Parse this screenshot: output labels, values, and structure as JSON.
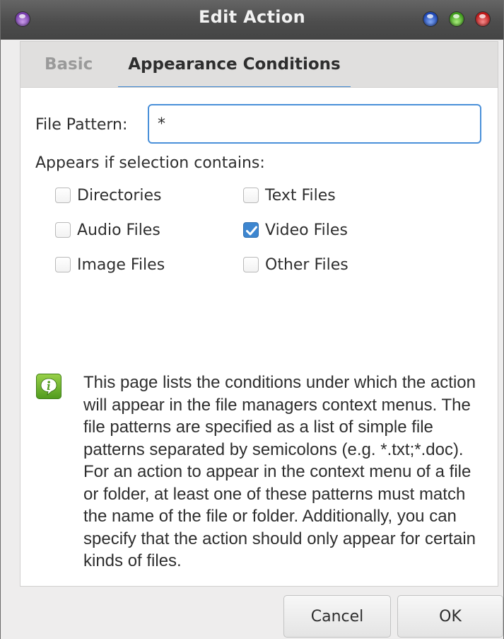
{
  "window": {
    "title": "Edit Action"
  },
  "tabs": [
    {
      "label": "Basic",
      "active": false
    },
    {
      "label": "Appearance Conditions",
      "active": true
    }
  ],
  "file_pattern": {
    "label": "File Pattern:",
    "value": "*"
  },
  "appears": {
    "label": "Appears if selection contains:",
    "options": [
      {
        "label": "Directories",
        "checked": false
      },
      {
        "label": "Text Files",
        "checked": false
      },
      {
        "label": "Audio Files",
        "checked": false
      },
      {
        "label": "Video Files",
        "checked": true
      },
      {
        "label": "Image Files",
        "checked": false
      },
      {
        "label": "Other Files",
        "checked": false
      }
    ]
  },
  "info": {
    "icon": "info-bubble-icon",
    "text": "This page lists the conditions under which the action will appear in the file managers context menus. The file patterns are specified as a list of simple file patterns separated by semicolons (e.g. *.txt;*.doc). For an action to appear in the context menu of a file or folder, at least one of these patterns must match the name of the file or folder. Additionally, you can specify that the action should only appear for certain kinds of files."
  },
  "buttons": {
    "cancel": "Cancel",
    "ok": "OK"
  },
  "colors": {
    "accent": "#3d86d0",
    "titlebar": "#4d4d4d"
  }
}
